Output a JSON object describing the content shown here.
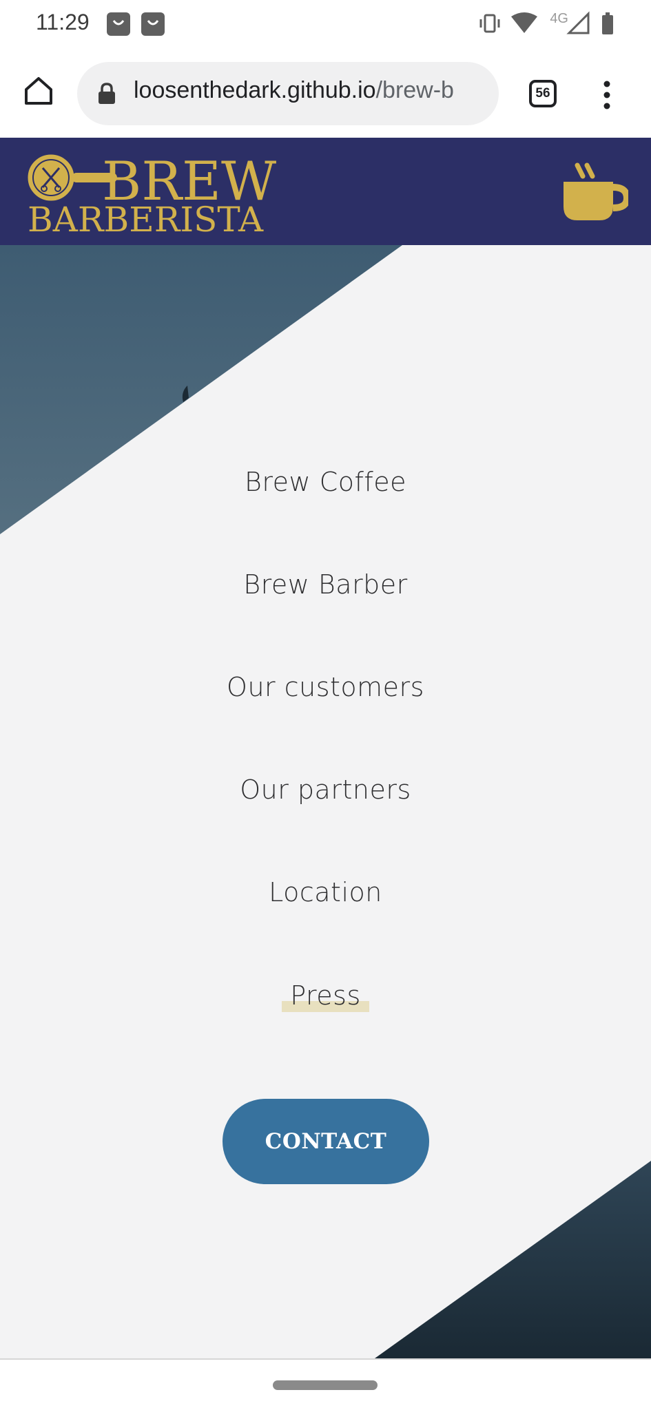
{
  "status_bar": {
    "time": "11:29",
    "notification_icons": [
      "shopping-bag-icon",
      "shopping-bag-icon"
    ],
    "network_label": "4G",
    "right_icons": [
      "vibrate-icon",
      "wifi-icon",
      "cell-signal-icon",
      "battery-icon"
    ]
  },
  "browser": {
    "url_host": "loosenthedark.github.io",
    "url_path": "/brew-b",
    "tab_count": "56",
    "icons": [
      "home-icon",
      "lock-icon",
      "more-vert-icon"
    ]
  },
  "site": {
    "logo": {
      "line1": "BREW",
      "line2": "BARBERISTA",
      "color": "#d2b14c"
    },
    "header_color": "#2c2f66",
    "accent_color": "#d2b14c",
    "menu_icon": "coffee-cup-icon"
  },
  "nav": {
    "items": [
      {
        "label": "Brew Coffee"
      },
      {
        "label": "Brew Barber"
      },
      {
        "label": "Our customers"
      },
      {
        "label": "Our partners"
      },
      {
        "label": "Location"
      },
      {
        "label": "Press",
        "active": true
      }
    ],
    "contact_label": "CONTACT",
    "contact_color": "#37729e"
  }
}
